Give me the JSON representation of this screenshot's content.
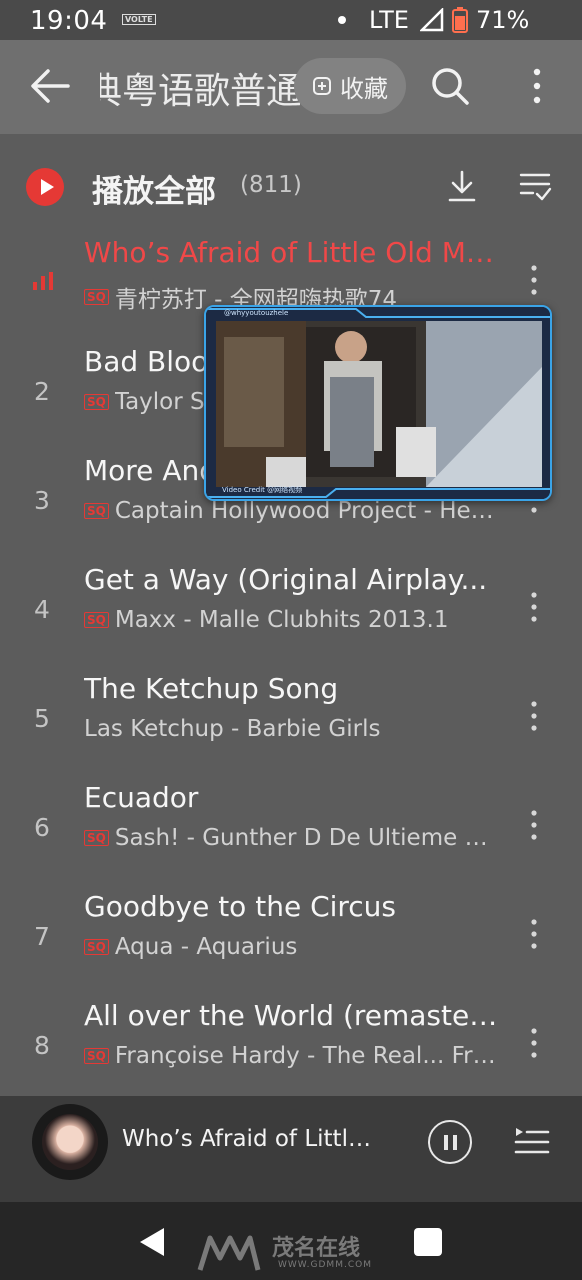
{
  "status_bar": {
    "time": "19:04",
    "volte": "VOLTE",
    "network": "LTE",
    "battery": "71%"
  },
  "app_bar": {
    "title": "典粤语歌普通",
    "favorite_label": "收藏"
  },
  "play_all": {
    "label": "播放全部",
    "count": "(811)"
  },
  "songs": [
    {
      "num": "",
      "title": "Who’s Afraid of Little Old Me...",
      "subtitle": "青柠苏打 - 全网超嗨热歌74",
      "sq": "SQ",
      "playing": true
    },
    {
      "num": "2",
      "title": "Bad Blood",
      "subtitle": "Taylor Swift",
      "sq": "SQ"
    },
    {
      "num": "3",
      "title": "More And More",
      "subtitle": "Captain Hollywood Project - Het...",
      "sq": "SQ"
    },
    {
      "num": "4",
      "title": "Get a Way (Original Airplay...",
      "subtitle": "Maxx - Malle Clubhits 2013.1",
      "sq": "SQ"
    },
    {
      "num": "5",
      "title": "The Ketchup Song",
      "subtitle": "Las Ketchup - Barbie Girls",
      "sq": ""
    },
    {
      "num": "6",
      "title": "Ecuador",
      "subtitle": "Sash! - Gunther D  De Ultieme Bo...",
      "sq": "SQ"
    },
    {
      "num": "7",
      "title": "Goodbye to the Circus",
      "subtitle": "Aqua - Aquarius",
      "sq": "SQ"
    },
    {
      "num": "8",
      "title": "All over the World (remaster...",
      "subtitle": "Françoise Hardy - The Real... Fra...",
      "sq": "SQ"
    }
  ],
  "pip": {
    "handle": "@whyyoutouzhele",
    "credit": "Video Credit @网络视频"
  },
  "mini_player": {
    "title": "Who’s Afraid of Little..."
  },
  "watermark": {
    "name": "茂名在线",
    "url": "WWW.GDMM.COM"
  },
  "colors": {
    "accent": "#e53935",
    "background": "#5c5c5c",
    "app_bar": "#6f6f6f",
    "mini_player": "#3c3c3c"
  }
}
